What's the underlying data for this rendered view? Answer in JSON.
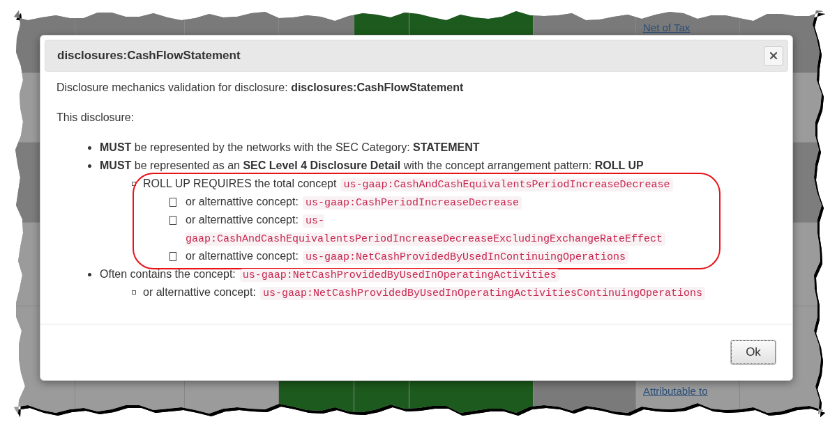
{
  "background": {
    "links": [
      "Net of Tax",
      "Attributable to"
    ]
  },
  "dialog": {
    "title": "disclosures:CashFlowStatement",
    "intro": "Disclosure mechanics validation for disclosure: **disclosures:CashFlowStatement**",
    "lead": "This disclosure:",
    "items": [
      {
        "text": "**MUST** be represented by the networks with the SEC Category: **STATEMENT**"
      },
      {
        "text": "**MUST** be represented as an **SEC Level 4 Disclosure Detail** with the concept arrangement pattern: **ROLL UP**",
        "children": [
          {
            "text": "ROLL UP REQUIRES the total concept",
            "code": "us-gaap:CashAndCashEquivalentsPeriodIncreaseDecrease",
            "children": [
              {
                "text": "or alternattive concept:",
                "code": "us-gaap:CashPeriodIncreaseDecrease"
              },
              {
                "text": "or alternattive concept:",
                "code": "us-gaap:CashAndCashEquivalentsPeriodIncreaseDecreaseExcludingExchangeRateEffect"
              },
              {
                "text": "or alternattive concept:",
                "code": "us-gaap:NetCashProvidedByUsedInContinuingOperations"
              }
            ]
          }
        ]
      },
      {
        "text": "Often contains the concept:",
        "code": "us-gaap:NetCashProvidedByUsedInOperatingActivities",
        "children": [
          {
            "text": "or alternattive concept:",
            "code": "us-gaap:NetCashProvidedByUsedInOperatingActivitiesContinuingOperations"
          }
        ]
      }
    ],
    "button": "Ok"
  }
}
